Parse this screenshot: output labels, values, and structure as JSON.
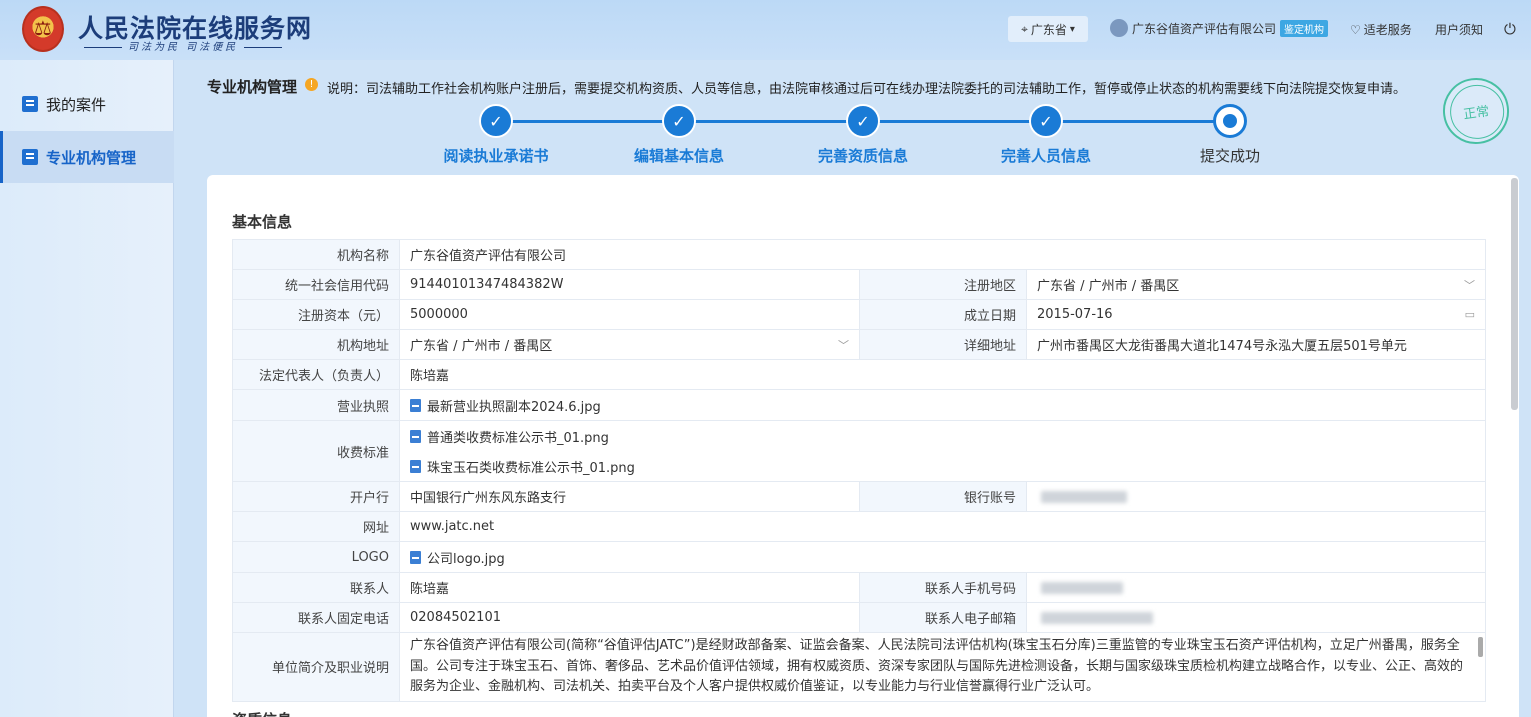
{
  "header": {
    "site_title": "人民法院在线服务网",
    "site_slogan": "司法为民 司法便民",
    "region": "广东省",
    "user_name": "广东谷值资产评估有限公司",
    "user_badge": "鉴定机构",
    "elder_service": "适老服务",
    "user_notice": "用户须知"
  },
  "sidebar": {
    "items": [
      {
        "label": "我的案件"
      },
      {
        "label": "专业机构管理"
      }
    ]
  },
  "page": {
    "title": "专业机构管理",
    "description": "说明：司法辅助工作社会机构账户注册后，需要提交机构资质、人员等信息，由法院审核通过后可在线办理法院委托的司法辅助工作，暂停或停止状态的机构需要线下向法院提交恢复申请。",
    "status_stamp": "正常"
  },
  "steps": [
    {
      "label": "阅读执业承诺书",
      "state": "done"
    },
    {
      "label": "编辑基本信息",
      "state": "done"
    },
    {
      "label": "完善资质信息",
      "state": "done"
    },
    {
      "label": "完善人员信息",
      "state": "done"
    },
    {
      "label": "提交成功",
      "state": "current"
    }
  ],
  "basic_info": {
    "section_title": "基本信息",
    "next_section_title": "资质信息",
    "org_name_label": "机构名称",
    "org_name": "广东谷值资产评估有限公司",
    "credit_code_label": "统一社会信用代码",
    "credit_code": "91440101347484382W",
    "reg_area_label": "注册地区",
    "reg_area": "广东省 / 广州市 / 番禺区",
    "capital_label": "注册资本（元）",
    "capital": "5000000",
    "found_date_label": "成立日期",
    "found_date": "2015-07-16",
    "address_label": "机构地址",
    "address": "广东省 / 广州市 / 番禺区",
    "detail_address_label": "详细地址",
    "detail_address": "广州市番禺区大龙街番禺大道北1474号永泓大厦五层501号单元",
    "legal_rep_label": "法定代表人（负责人）",
    "legal_rep": "陈培嘉",
    "license_label": "营业执照",
    "license_file": "最新营业执照副本2024.6.jpg",
    "fee_label": "收费标准",
    "fee_file_1": "普通类收费标准公示书_01.png",
    "fee_file_2": "珠宝玉石类收费标准公示书_01.png",
    "bank_label": "开户行",
    "bank": "中国银行广州东风东路支行",
    "account_label": "银行账号",
    "website_label": "网址",
    "website": "www.jatc.net",
    "logo_label": "LOGO",
    "logo_file": "公司logo.jpg",
    "contact_label": "联系人",
    "contact": "陈培嘉",
    "mobile_label": "联系人手机号码",
    "phone_label": "联系人固定电话",
    "phone": "02084502101",
    "email_label": "联系人电子邮箱",
    "intro_label": "单位简介及职业说明",
    "intro": "广东谷值资产评估有限公司(简称“谷值评估JATC”)是经财政部备案、证监会备案、人民法院司法评估机构(珠宝玉石分库)三重监管的专业珠宝玉石资产评估机构，立足广州番禺，服务全国。公司专注于珠宝玉石、首饰、奢侈品、艺术品价值评估领域，拥有权威资质、资深专家团队与国际先进检测设备，长期与国家级珠宝质检机构建立战略合作，以专业、公正、高效的服务为企业、金融机构、司法机关、拍卖平台及个人客户提供权威价值鉴证，以专业能力与行业信誉赢得行业广泛认可。"
  }
}
